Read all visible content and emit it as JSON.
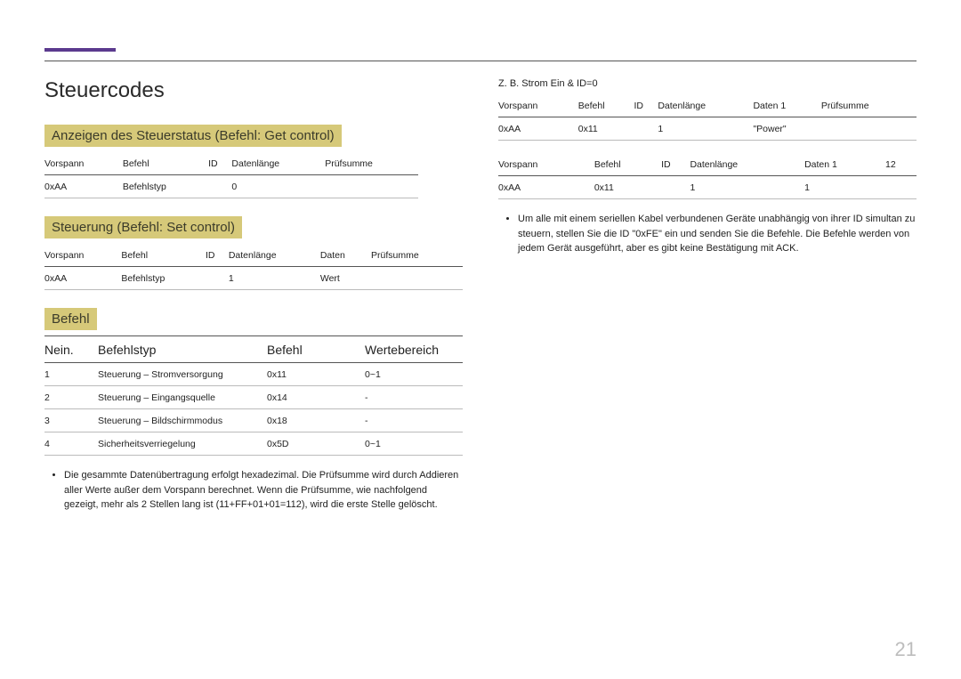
{
  "page_number": "21",
  "left": {
    "title": "Steuercodes",
    "get_control": {
      "heading": "Anzeigen des Steuerstatus (Befehl: Get control)",
      "headers": [
        "Vorspann",
        "Befehl",
        "ID",
        "Datenlänge",
        "Prüfsumme"
      ],
      "row": [
        "0xAA",
        "Befehlstyp",
        "",
        "0",
        ""
      ]
    },
    "set_control": {
      "heading": "Steuerung (Befehl: Set control)",
      "headers": [
        "Vorspann",
        "Befehl",
        "ID",
        "Datenlänge",
        "Daten",
        "Prüfsumme"
      ],
      "row": [
        "0xAA",
        "Befehlstyp",
        "",
        "1",
        "Wert",
        ""
      ]
    },
    "command": {
      "heading": "Befehl",
      "headers": [
        "Nein.",
        "Befehlstyp",
        "Befehl",
        "Wertebereich"
      ],
      "rows": [
        [
          "1",
          "Steuerung – Stromversorgung",
          "0x11",
          "0~1"
        ],
        [
          "2",
          "Steuerung – Eingangsquelle",
          "0x14",
          "-"
        ],
        [
          "3",
          "Steuerung – Bildschirmmodus",
          "0x18",
          "-"
        ],
        [
          "4",
          "Sicherheitsverriegelung",
          "0x5D",
          "0~1"
        ]
      ]
    },
    "footnote": "Die gesammte Datenübertragung erfolgt hexadezimal. Die Prüfsumme wird durch Addieren aller Werte außer dem Vorspann berechnet. Wenn die Prüfsumme, wie nachfolgend gezeigt, mehr als 2 Stellen lang ist (11+FF+01+01=112), wird die erste Stelle gelöscht."
  },
  "right": {
    "example_label": "Z. B. Strom Ein & ID=0",
    "t1": {
      "headers": [
        "Vorspann",
        "Befehl",
        "ID",
        "Datenlänge",
        "Daten 1",
        "Prüfsumme"
      ],
      "row": [
        "0xAA",
        "0x11",
        "",
        "1",
        "\"Power\"",
        ""
      ]
    },
    "t2": {
      "headers": [
        "Vorspann",
        "Befehl",
        "ID",
        "Datenlänge",
        "Daten 1",
        "12"
      ],
      "row": [
        "0xAA",
        "0x11",
        "",
        "1",
        "1",
        ""
      ]
    },
    "footnote": "Um alle mit einem seriellen Kabel verbundenen Geräte unabhängig von ihrer ID simultan zu steuern, stellen Sie die ID \"0xFE\" ein und senden Sie die Befehle. Die Befehle werden von jedem Gerät ausgeführt, aber es gibt keine Bestätigung mit ACK."
  }
}
